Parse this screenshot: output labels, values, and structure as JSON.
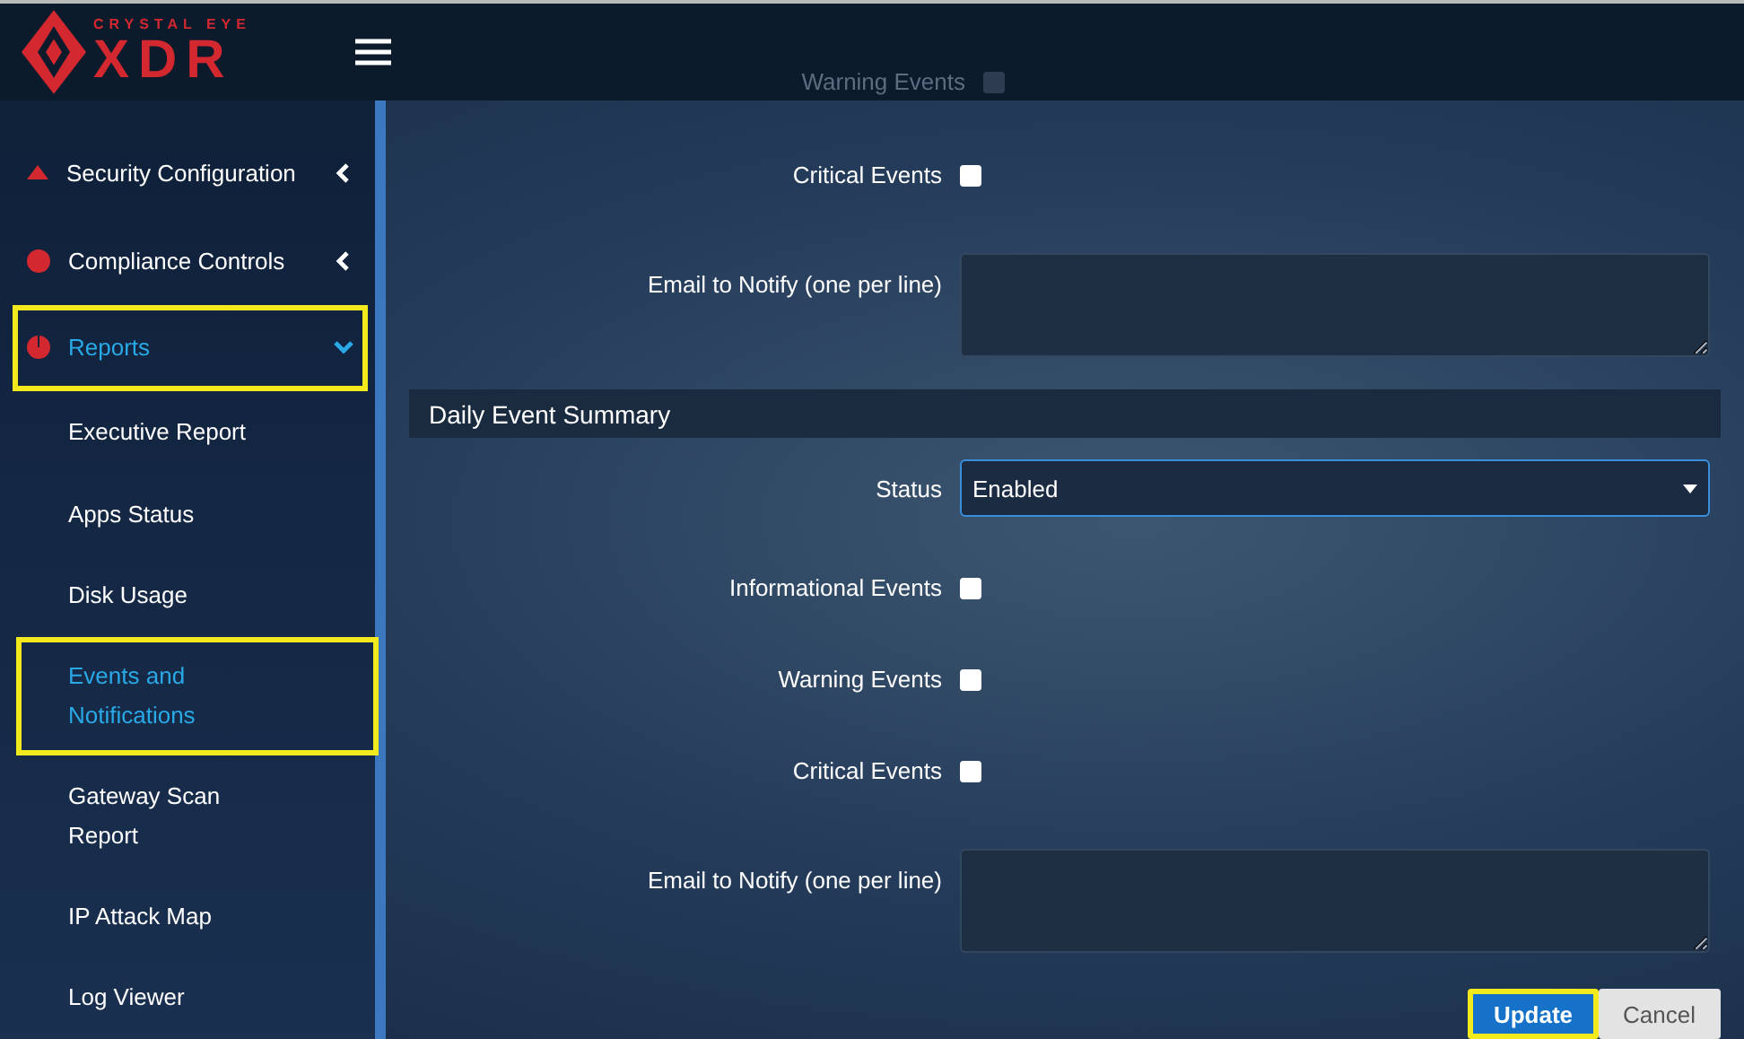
{
  "header": {
    "logo_top": "CRYSTAL EYE",
    "logo_main": "XDR"
  },
  "sidebar": {
    "items": [
      {
        "label": "Security Configuration",
        "expanded": false,
        "highlighted": false,
        "selected": false
      },
      {
        "label": "Compliance Controls",
        "expanded": false,
        "highlighted": false,
        "selected": false
      },
      {
        "label": "Reports",
        "expanded": true,
        "highlighted": true,
        "selected": true,
        "children": [
          {
            "label": "Executive Report",
            "selected": false,
            "highlighted": false
          },
          {
            "label": "Apps Status",
            "selected": false,
            "highlighted": false
          },
          {
            "label": "Disk Usage",
            "selected": false,
            "highlighted": false
          },
          {
            "label": "Events and Notifications",
            "selected": true,
            "highlighted": true
          },
          {
            "label": "Gateway Scan Report",
            "selected": false,
            "highlighted": false
          },
          {
            "label": "IP Attack Map",
            "selected": false,
            "highlighted": false
          },
          {
            "label": "Log Viewer",
            "selected": false,
            "highlighted": false
          }
        ]
      }
    ]
  },
  "form": {
    "rows": [
      {
        "kind": "checkbox",
        "label": "Warning Events",
        "checked": false,
        "covered": true
      },
      {
        "kind": "checkbox",
        "label": "Critical Events",
        "checked": false
      },
      {
        "kind": "textarea",
        "label": "Email to Notify (one per line)"
      },
      {
        "kind": "section",
        "label": "Daily Event Summary"
      },
      {
        "kind": "select",
        "label": "Status",
        "value": "Enabled"
      },
      {
        "kind": "checkbox",
        "label": "Informational Events",
        "checked": false
      },
      {
        "kind": "checkbox",
        "label": "Warning Events",
        "checked": false
      },
      {
        "kind": "checkbox",
        "label": "Critical Events",
        "checked": false
      },
      {
        "kind": "textarea",
        "label": "Email to Notify (one per line)"
      }
    ]
  },
  "buttons": [
    {
      "label": "Update",
      "kind": "primary",
      "highlighted": true
    },
    {
      "label": "Cancel",
      "kind": "secondary",
      "highlighted": false
    }
  ]
}
